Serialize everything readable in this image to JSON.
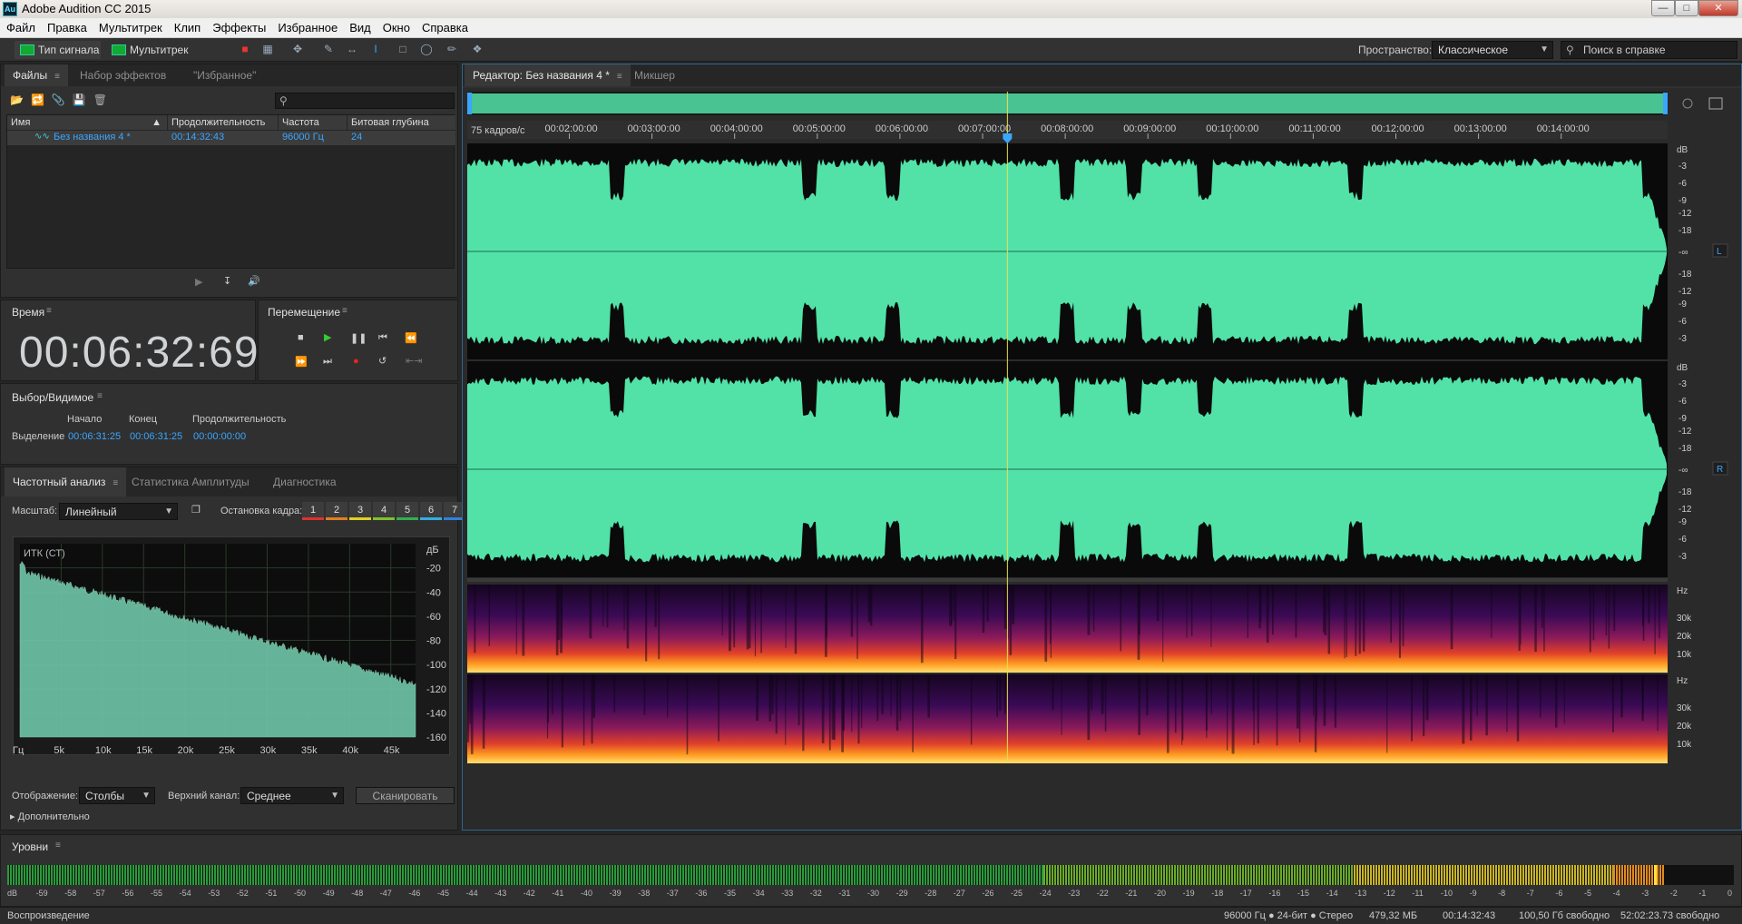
{
  "titlebar": {
    "app_title": "Adobe Audition CC 2015",
    "logo_text": "Au"
  },
  "menu": [
    "Файл",
    "Правка",
    "Мультитрек",
    "Клип",
    "Эффекты",
    "Избранное",
    "Вид",
    "Окно",
    "Справка"
  ],
  "toolbar": {
    "mode_waveform": "Тип сигнала",
    "mode_multitrack": "Мультитрек",
    "workspace_label": "Пространство:",
    "workspace_value": "Классическое",
    "search_help": "Поиск в справке"
  },
  "files": {
    "tabs": [
      "Файлы",
      "Набор эффектов",
      "\"Избранное\""
    ],
    "columns": [
      "Имя",
      "Продолжительность",
      "Частота",
      "Битовая глубина"
    ],
    "rows": [
      {
        "name": "Без названия 4 *",
        "duration": "00:14:32:43",
        "rate": "96000 Гц",
        "depth": "24"
      }
    ]
  },
  "time": {
    "label": "Время",
    "value": "00:06:32:69"
  },
  "transport": {
    "label": "Перемещение"
  },
  "selection": {
    "label": "Выбор/Видимое",
    "col_start": "Начало",
    "col_end": "Конец",
    "col_duration": "Продолжительность",
    "row_label": "Выделение",
    "start": "00:06:31:25",
    "end": "00:06:31:25",
    "duration": "00:00:00:00"
  },
  "freq": {
    "tabs": [
      "Частотный анализ",
      "Статистика Амплитуды",
      "Диагностика"
    ],
    "scale_label": "Масштаб:",
    "scale_value": "Линейный",
    "freeze_label": "Остановка кадра:",
    "freeze_slots": [
      "1",
      "2",
      "3",
      "4",
      "5",
      "6",
      "7"
    ],
    "freeze_colors": [
      "#e03030",
      "#e08020",
      "#e0d020",
      "#80c030",
      "#30b050",
      "#30b0e0",
      "#3080e0"
    ],
    "graph_title": "ИТК (СТ)",
    "db_unit": "дБ",
    "db_ticks": [
      "-20",
      "-40",
      "-60",
      "-80",
      "-100",
      "-120",
      "-140",
      "-160"
    ],
    "hz_unit": "Гц",
    "hz_ticks": [
      "5k",
      "10k",
      "15k",
      "20k",
      "25k",
      "30k",
      "35k",
      "40k",
      "45k"
    ],
    "display_label": "Отображение:",
    "display_value": "Столбы",
    "top_channel_label": "Верхний канал:",
    "top_channel_value": "Среднее",
    "scan_button": "Сканировать",
    "advanced_label": "Дополнительно"
  },
  "editor": {
    "tabs": [
      "Редактор: Без названия 4 *",
      "Микшер"
    ],
    "frame_rate": "75 кадров/с",
    "ruler": [
      "00:02:00:00",
      "00:03:00:00",
      "00:04:00:00",
      "00:05:00:00",
      "00:06:00:00",
      "00:07:00:00",
      "00:08:00:00",
      "00:09:00:00",
      "00:10:00:00",
      "00:11:00:00",
      "00:12:00:00",
      "00:13:00:00",
      "00:14:00:00"
    ],
    "db_unit": "dB",
    "db_scale_top": [
      "-3",
      "-6",
      "-9",
      "-12",
      "-18",
      "-∞",
      "-18",
      "-12",
      "-9",
      "-6",
      "-3"
    ],
    "channel_L": "L",
    "channel_R": "R",
    "hz_unit": "Hz",
    "hz_ticks": [
      "30k",
      "20k",
      "10k"
    ],
    "playhead_fraction": 0.45,
    "waveform_color": "#52e2a8"
  },
  "levels": {
    "label": "Уровни",
    "ticks": [
      "dB",
      "-59",
      "-58",
      "-57",
      "-56",
      "-55",
      "-54",
      "-53",
      "-52",
      "-51",
      "-50",
      "-49",
      "-48",
      "-47",
      "-46",
      "-45",
      "-44",
      "-43",
      "-42",
      "-41",
      "-40",
      "-39",
      "-38",
      "-37",
      "-36",
      "-35",
      "-34",
      "-33",
      "-32",
      "-31",
      "-30",
      "-29",
      "-28",
      "-27",
      "-26",
      "-25",
      "-24",
      "-23",
      "-22",
      "-21",
      "-20",
      "-19",
      "-18",
      "-17",
      "-16",
      "-15",
      "-14",
      "-13",
      "-12",
      "-11",
      "-10",
      "-9",
      "-8",
      "-7",
      "-6",
      "-5",
      "-4",
      "-3",
      "-2",
      "-1",
      "0"
    ]
  },
  "status": {
    "left": "Воспроизведение",
    "format": "96000 Гц ● 24-бит ● Стерео",
    "size": "479,32 МБ",
    "duration": "00:14:32:43",
    "free": "100,50 Гб свободно",
    "free_time": "52:02:23.73 свободно"
  }
}
